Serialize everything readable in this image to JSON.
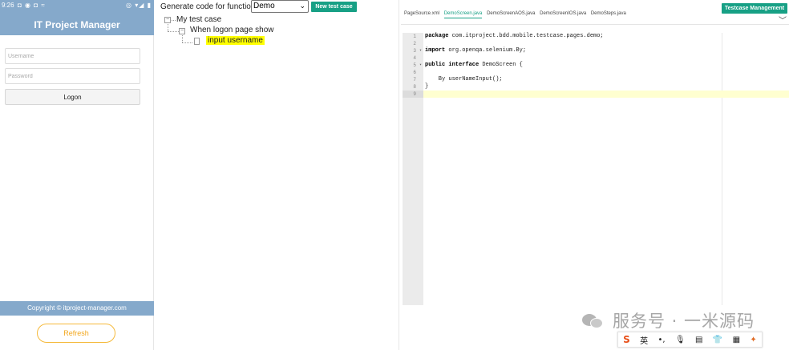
{
  "phone": {
    "status": {
      "time": "9:26",
      "left_icons": "◘ ◉ ◘ ≈",
      "right_icons": "◎ ▾◢ ▮"
    },
    "app_title": "IT Project Manager",
    "username_placeholder": "Username",
    "password_placeholder": "Password",
    "logon_label": "Logon",
    "copyright": "Copyright © itproject-manager.com",
    "refresh_label": "Refresh",
    "colors": {
      "header": "#85a9cb",
      "refresh_accent": "#f5b93a"
    }
  },
  "generator": {
    "label": "Generate code for function:",
    "function_selected": "Demo",
    "new_test_case_label": "New test case",
    "accent": "#17a085"
  },
  "tree": {
    "root": "My test case",
    "child": "When logon page show",
    "leaf": "input username"
  },
  "editor": {
    "tabs": [
      {
        "label": "PageSource.xml",
        "active": false
      },
      {
        "label": "DemoScreen.java",
        "active": true
      },
      {
        "label": "DemoScreenAOS.java",
        "active": false
      },
      {
        "label": "DemoScreenIOS.java",
        "active": false
      },
      {
        "label": "DemoSteps.java",
        "active": false
      }
    ],
    "testcase_management_label": "Testcase Management",
    "chevron": "﹀",
    "line_numbers": [
      "1",
      "2",
      "3",
      "4",
      "5",
      "6",
      "7",
      "8",
      "9"
    ],
    "lines": [
      {
        "kw": "package",
        "rest": " com.itproject.bdd.mobile.testcase.pages.demo;"
      },
      {
        "kw": "",
        "rest": ""
      },
      {
        "kw": "import",
        "rest": " org.openqa.selenium.By;"
      },
      {
        "kw": "",
        "rest": ""
      },
      {
        "kw": "public interface",
        "rest": " DemoScreen {"
      },
      {
        "kw": "",
        "rest": ""
      },
      {
        "kw": "",
        "rest": "    By userNameInput();"
      },
      {
        "kw": "",
        "rest": "}"
      },
      {
        "kw": "",
        "rest": ""
      }
    ],
    "current_line": 9
  },
  "watermark": {
    "text": "服务号 · 一米源码"
  },
  "ime": {
    "items": [
      "S",
      "英",
      "•,",
      "🎙",
      "▤",
      "👕",
      "▦",
      "✦"
    ]
  }
}
